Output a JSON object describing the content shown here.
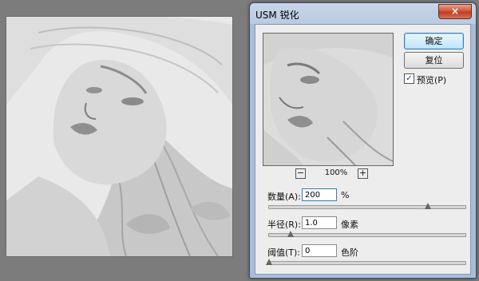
{
  "dialog": {
    "title": "USM 锐化",
    "close_glyph": "×",
    "ok_label": "确定",
    "reset_label": "复位",
    "preview_checkbox": {
      "label": "预览(P)",
      "checked": true,
      "glyph": "✓"
    }
  },
  "zoom": {
    "out_glyph": "−",
    "level": "100%",
    "in_glyph": "+"
  },
  "params": {
    "amount": {
      "label": "数量(A):",
      "value": "200",
      "unit": "%",
      "slider_fraction": 0.81
    },
    "radius": {
      "label": "半径(R):",
      "value": "1.0",
      "unit": "像素",
      "slider_fraction": 0.11
    },
    "threshold": {
      "label": "阈值(T):",
      "value": "0",
      "unit": "色阶",
      "slider_fraction": 0.0
    }
  },
  "colors": {
    "workspace": "#7c7c7c",
    "dialog_frame": "#b8cbe2",
    "close_button": "#c03c22",
    "default_button": "#bee6fd"
  }
}
